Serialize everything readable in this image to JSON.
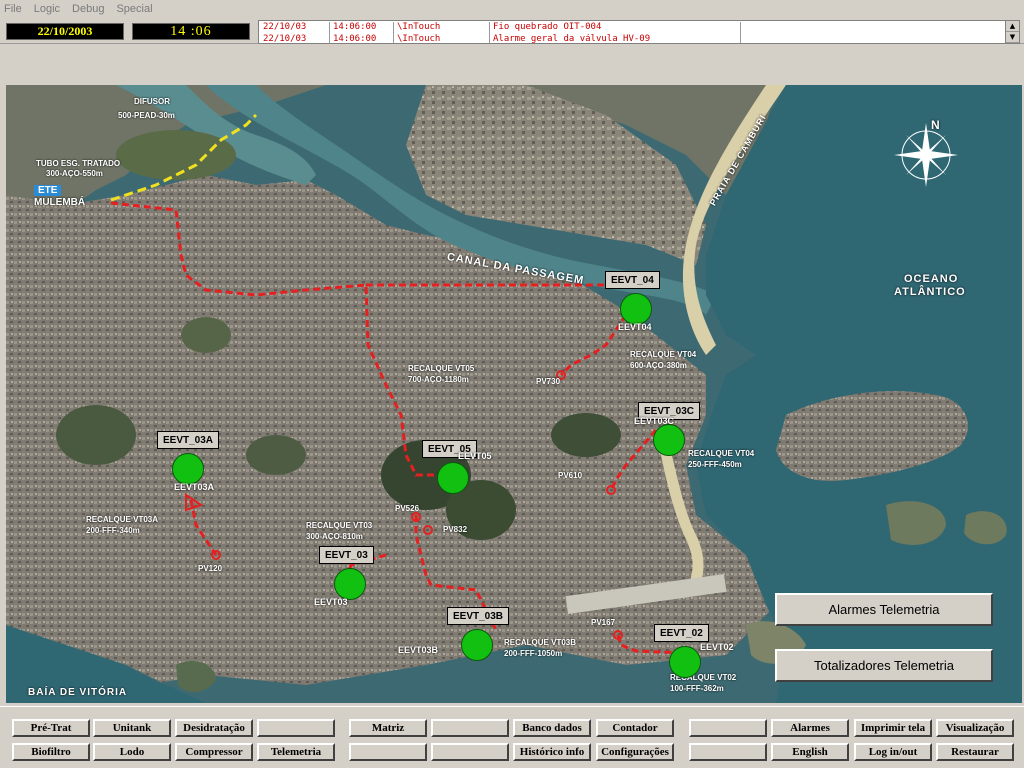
{
  "menu": [
    "File",
    "Logic",
    "Debug",
    "Special"
  ],
  "header": {
    "date": "22/10/2003",
    "time": "14 :06"
  },
  "alarms": [
    {
      "date": "22/10/03",
      "time": "14:06:00",
      "source": "\\InTouch",
      "message": "Fio quebrado OIT-004"
    },
    {
      "date": "22/10/03",
      "time": "14:06:00",
      "source": "\\InTouch",
      "message": "Alarme geral da válvula HV-09"
    }
  ],
  "map": {
    "labels": {
      "difusor": "DIFUSOR",
      "difusor_sub": "500-PEAD-30m",
      "tubo": "TUBO ESG. TRATADO",
      "tubo_sub": "300-AÇO-550m",
      "ete": "ETE",
      "mulembaa": "MULEMBÁ",
      "canal": "CANAL DA PASSAGEM",
      "praia": "PRAIA DE CAMBURI",
      "oceano": "OCEANO",
      "atlantico": "ATLÂNTICO",
      "baia": "BAÍA DE VITÓRIA",
      "recalque_vt05": "RECALQUE VT05",
      "recalque_vt05_sub": "700-AÇO-1180m",
      "recalque_vt04_left": "RECALQUE VT04",
      "recalque_vt04_left_sub": "600-AÇO-380m",
      "recalque_vt04": "RECALQUE VT04",
      "recalque_vt04_sub": "250-FFF-450m",
      "recalque_vt03a": "RECALQUE VT03A",
      "recalque_vt03a_sub": "200-FFF-340m",
      "recalque_vt03": "RECALQUE VT03",
      "recalque_vt03_sub": "300-AÇO-810m",
      "recalque_vt03b": "RECALQUE VT03B",
      "recalque_vt03b_sub": "200-FFF-1050m",
      "recalque_vt02": "RECALQUE VT02",
      "recalque_vt02_sub": "100-FFF-362m",
      "pv730": "PV730",
      "pv610": "PV610",
      "pv526": "PV526",
      "pv832": "PV832",
      "pv120": "PV120",
      "pv167": "PV167"
    },
    "stations": [
      {
        "tag": "EEVT_04",
        "code": "EEVT04"
      },
      {
        "tag": "EEVT_03C",
        "code": "EEVT03C"
      },
      {
        "tag": "EEVT_03A",
        "code": "EEVT03A"
      },
      {
        "tag": "EEVT_05",
        "code": "EEVT05"
      },
      {
        "tag": "EEVT_03",
        "code": "EEVT03"
      },
      {
        "tag": "EEVT_03B",
        "code": "EEVT03B"
      },
      {
        "tag": "EEVT_02",
        "code": "EEVT02"
      }
    ],
    "compass": "N",
    "buttons": {
      "alarmes": "Alarmes Telemetria",
      "totalizadores": "Totalizadores Telemetria"
    }
  },
  "colors": {
    "station_ok": "#12c012",
    "pipeline": "#e52020",
    "treated_outfall": "#f0e020",
    "clock_text": "#ffff00",
    "alarm_text": "#c80000"
  },
  "nav": {
    "row1": [
      "Pré-Trat",
      "Unitank",
      "Desidratação",
      "",
      "Matriz",
      "",
      "Banco dados",
      "Contador",
      "",
      "Alarmes",
      "Imprimir tela",
      "Visualização"
    ],
    "row2": [
      "Biofiltro",
      "Lodo",
      "Compressor",
      "Telemetria",
      "",
      "",
      "Histórico info",
      "Configurações",
      "",
      "English",
      "Log in/out",
      "Restaurar"
    ]
  }
}
